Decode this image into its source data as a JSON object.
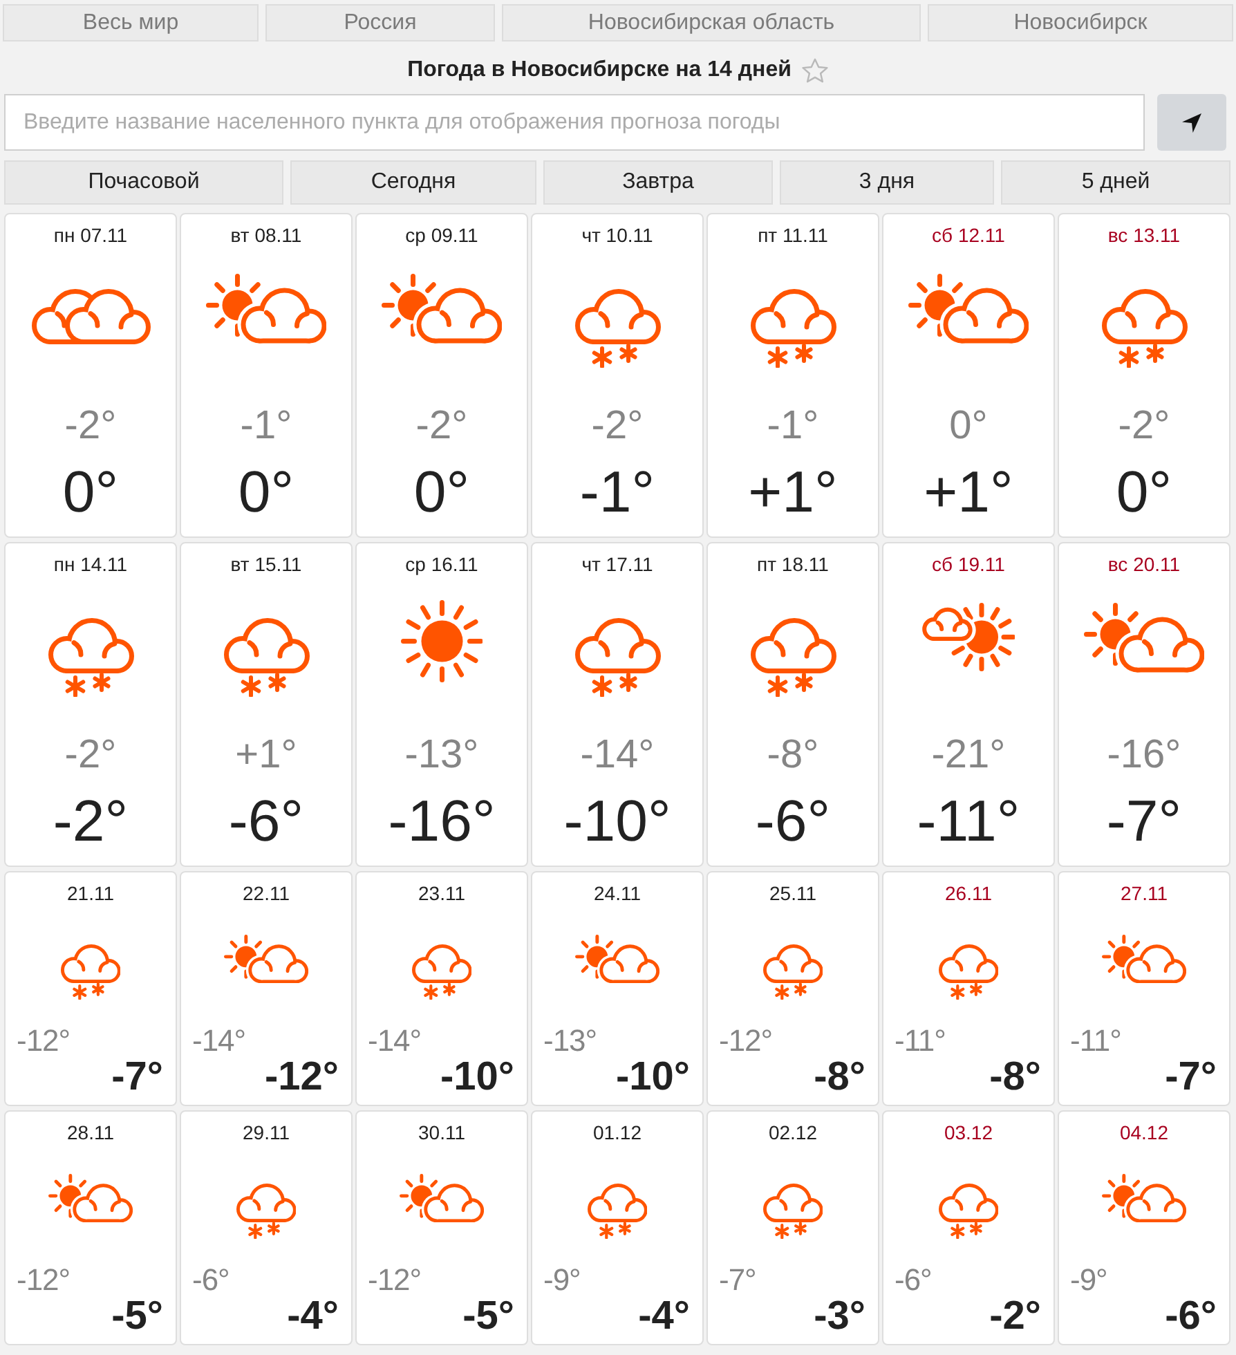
{
  "region_links": [
    "Весь мир",
    "Россия",
    "Новосибирская область",
    "Новосибирск"
  ],
  "title": "Погода в Новосибирске на 14 дней",
  "search": {
    "placeholder": "Введите название населенного пункта для отображения прогноза погоды"
  },
  "period_tabs": [
    "Почасовой",
    "Сегодня",
    "Завтра",
    "3 дня",
    "5 дней"
  ],
  "weeks": [
    {
      "kind": "large",
      "days": [
        {
          "date": "пн 07.11",
          "weekend": false,
          "kind": "overcast",
          "minor_temp": "-2°",
          "major_temp": "0°"
        },
        {
          "date": "вт 08.11",
          "weekend": false,
          "kind": "partly_cloudy",
          "minor_temp": "-1°",
          "major_temp": "0°"
        },
        {
          "date": "ср 09.11",
          "weekend": false,
          "kind": "partly_cloudy",
          "minor_temp": "-2°",
          "major_temp": "0°"
        },
        {
          "date": "чт 10.11",
          "weekend": false,
          "kind": "snow",
          "minor_temp": "-2°",
          "major_temp": "-1°"
        },
        {
          "date": "пт 11.11",
          "weekend": false,
          "kind": "snow",
          "minor_temp": "-1°",
          "major_temp": "+1°"
        },
        {
          "date": "сб 12.11",
          "weekend": true,
          "kind": "partly_cloudy",
          "minor_temp": "0°",
          "major_temp": "+1°"
        },
        {
          "date": "вс 13.11",
          "weekend": true,
          "kind": "snow",
          "minor_temp": "-2°",
          "major_temp": "0°"
        }
      ]
    },
    {
      "kind": "large",
      "days": [
        {
          "date": "пн 14.11",
          "weekend": false,
          "kind": "snow",
          "minor_temp": "-2°",
          "major_temp": "-2°"
        },
        {
          "date": "вт 15.11",
          "weekend": false,
          "kind": "snow",
          "minor_temp": "+1°",
          "major_temp": "-6°"
        },
        {
          "date": "ср 16.11",
          "weekend": false,
          "kind": "clear",
          "minor_temp": "-13°",
          "major_temp": "-16°"
        },
        {
          "date": "чт 17.11",
          "weekend": false,
          "kind": "snow",
          "minor_temp": "-14°",
          "major_temp": "-10°"
        },
        {
          "date": "пт 18.11",
          "weekend": false,
          "kind": "snow",
          "minor_temp": "-8°",
          "major_temp": "-6°"
        },
        {
          "date": "сб 19.11",
          "weekend": true,
          "kind": "sunny_cloud",
          "minor_temp": "-21°",
          "major_temp": "-11°"
        },
        {
          "date": "вс 20.11",
          "weekend": true,
          "kind": "partly_cloudy",
          "minor_temp": "-16°",
          "major_temp": "-7°"
        }
      ]
    },
    {
      "kind": "compact",
      "days": [
        {
          "date": "21.11",
          "weekend": false,
          "kind": "snow",
          "minor_temp": "-12°",
          "major_temp": "-7°"
        },
        {
          "date": "22.11",
          "weekend": false,
          "kind": "partly_cloudy",
          "minor_temp": "-14°",
          "major_temp": "-12°"
        },
        {
          "date": "23.11",
          "weekend": false,
          "kind": "snow",
          "minor_temp": "-14°",
          "major_temp": "-10°"
        },
        {
          "date": "24.11",
          "weekend": false,
          "kind": "partly_cloudy",
          "minor_temp": "-13°",
          "major_temp": "-10°"
        },
        {
          "date": "25.11",
          "weekend": false,
          "kind": "snow",
          "minor_temp": "-12°",
          "major_temp": "-8°"
        },
        {
          "date": "26.11",
          "weekend": true,
          "kind": "snow",
          "minor_temp": "-11°",
          "major_temp": "-8°"
        },
        {
          "date": "27.11",
          "weekend": true,
          "kind": "partly_cloudy",
          "minor_temp": "-11°",
          "major_temp": "-7°"
        }
      ]
    },
    {
      "kind": "compact",
      "days": [
        {
          "date": "28.11",
          "weekend": false,
          "kind": "partly_cloudy",
          "minor_temp": "-12°",
          "major_temp": "-5°"
        },
        {
          "date": "29.11",
          "weekend": false,
          "kind": "snow",
          "minor_temp": "-6°",
          "major_temp": "-4°"
        },
        {
          "date": "30.11",
          "weekend": false,
          "kind": "partly_cloudy",
          "minor_temp": "-12°",
          "major_temp": "-5°"
        },
        {
          "date": "01.12",
          "weekend": false,
          "kind": "snow",
          "minor_temp": "-9°",
          "major_temp": "-4°"
        },
        {
          "date": "02.12",
          "weekend": false,
          "kind": "snow",
          "minor_temp": "-7°",
          "major_temp": "-3°"
        },
        {
          "date": "03.12",
          "weekend": true,
          "kind": "snow",
          "minor_temp": "-6°",
          "major_temp": "-2°"
        },
        {
          "date": "04.12",
          "weekend": true,
          "kind": "partly_cloudy",
          "minor_temp": "-9°",
          "major_temp": "-6°"
        }
      ]
    }
  ]
}
